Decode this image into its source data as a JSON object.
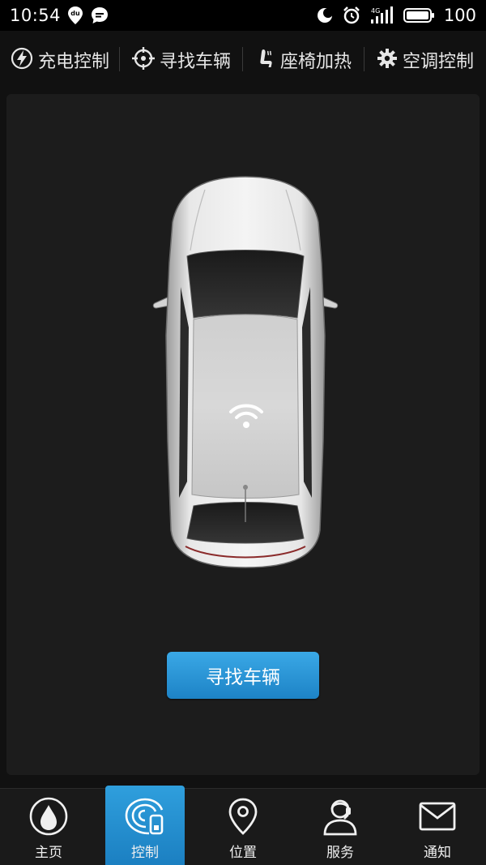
{
  "status_bar": {
    "time": "10:54",
    "network": "4G",
    "battery": "100",
    "left_icons": [
      "du-location-icon",
      "message-bubble-icon"
    ],
    "right_icons": [
      "moon-icon",
      "alarm-icon",
      "signal-icon",
      "battery-icon"
    ]
  },
  "tabs": [
    {
      "label": "充电控制",
      "icon": "lightning-icon"
    },
    {
      "label": "寻找车辆",
      "icon": "crosshair-icon",
      "active": true
    },
    {
      "label": "座椅加热",
      "icon": "seat-icon"
    },
    {
      "label": "空调控制",
      "icon": "gear-icon"
    }
  ],
  "main": {
    "find_button_label": "寻找车辆",
    "signal_icon": "wifi-signal-icon"
  },
  "bottom_nav": [
    {
      "label": "主页",
      "icon": "drop-icon"
    },
    {
      "label": "控制",
      "icon": "remote-control-icon",
      "active": true
    },
    {
      "label": "位置",
      "icon": "location-pin-icon"
    },
    {
      "label": "服务",
      "icon": "service-agent-icon"
    },
    {
      "label": "通知",
      "icon": "envelope-icon"
    }
  ],
  "colors": {
    "accent": "#2ea0dc",
    "background": "#111111",
    "panel": "#1c1c1c"
  }
}
